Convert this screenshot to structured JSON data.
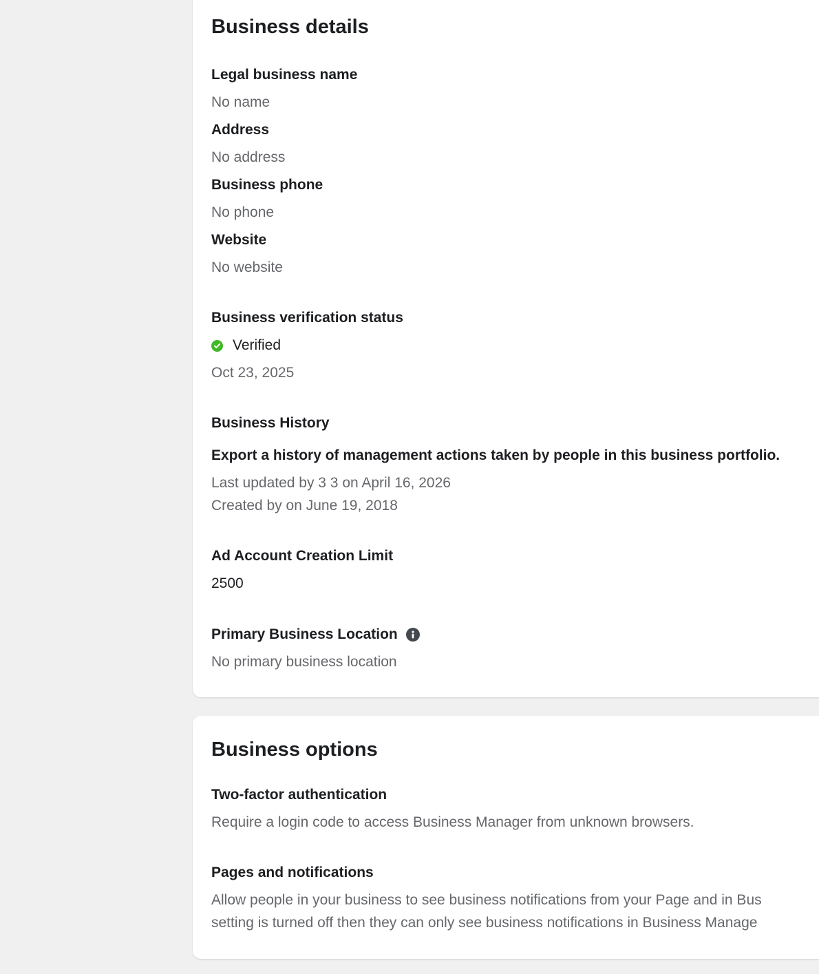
{
  "details": {
    "title": "Business details",
    "legal_name_label": "Legal business name",
    "legal_name_value": "No name",
    "address_label": "Address",
    "address_value": "No address",
    "phone_label": "Business phone",
    "phone_value": "No phone",
    "website_label": "Website",
    "website_value": "No website",
    "verification_label": "Business verification status",
    "verification_status": "Verified",
    "verification_date": "Oct 23, 2025",
    "history_label": "Business History",
    "history_export": "Export a history of management actions taken by people in this business portfolio.",
    "history_last_updated": "Last updated by 3 3 on April 16, 2026",
    "history_created": "Created by on June 19, 2018",
    "ad_limit_label": "Ad Account Creation Limit",
    "ad_limit_value": "2500",
    "primary_location_label": "Primary Business Location",
    "primary_location_value": "No primary business location"
  },
  "options": {
    "title": "Business options",
    "two_factor_label": "Two-factor authentication",
    "two_factor_desc": "Require a login code to access Business Manager from unknown browsers.",
    "pages_label": "Pages and notifications",
    "pages_desc_line1": "Allow people in your business to see business notifications from your Page and in Bus",
    "pages_desc_line2": "setting is turned off then they can only see business notifications in Business Manage"
  },
  "icons": {
    "verified": "check-circle-icon",
    "info": "info-icon"
  },
  "colors": {
    "verified_green": "#42b72a",
    "page_background": "#f0f0f0",
    "muted_text": "#65676b"
  }
}
